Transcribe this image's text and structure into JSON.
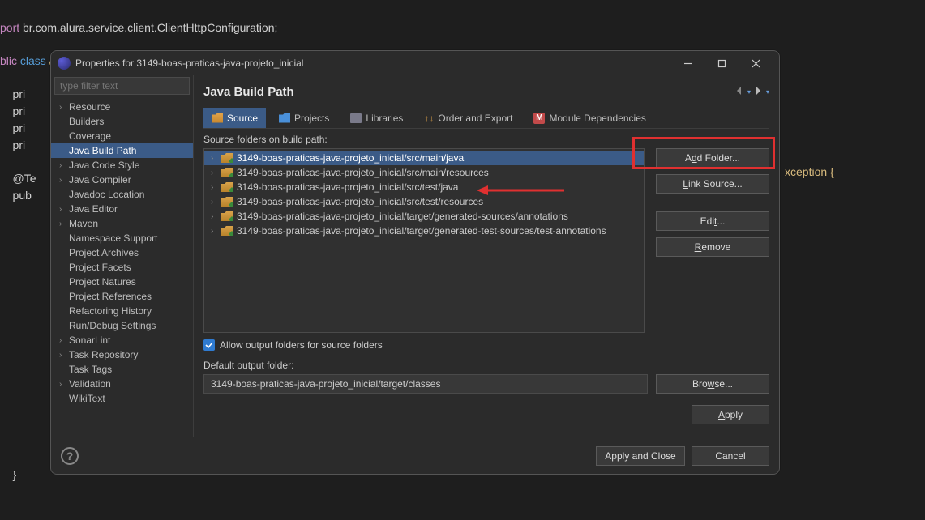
{
  "code": {
    "l1a": "port ",
    "l1b": "br.com.alura.service.client.ClientHttpConfiguration;",
    "l2a": "blic ",
    "l2b": "class ",
    "l2c": "AbrigoServiceTest ",
    "l2d": "{",
    "p1": "    pr",
    "p1b": "i",
    "p2": "    pr",
    "p2b": "i",
    "p3": "    pr",
    "p3b": "i",
    "p4": "    pr",
    "p4b": "i",
    "t1": "    @Te",
    "pu": "    pub",
    "tail": "xception {",
    "brace": "    }"
  },
  "dialog": {
    "title": "Properties for 3149-boas-praticas-java-projeto_inicial",
    "filter_placeholder": "type filter text",
    "sidebar": [
      {
        "label": "Resource",
        "expand": true
      },
      {
        "label": "Builders"
      },
      {
        "label": "Coverage"
      },
      {
        "label": "Java Build Path",
        "selected": true
      },
      {
        "label": "Java Code Style",
        "expand": true
      },
      {
        "label": "Java Compiler",
        "expand": true
      },
      {
        "label": "Javadoc Location"
      },
      {
        "label": "Java Editor",
        "expand": true
      },
      {
        "label": "Maven",
        "expand": true
      },
      {
        "label": "Namespace Support"
      },
      {
        "label": "Project Archives"
      },
      {
        "label": "Project Facets"
      },
      {
        "label": "Project Natures"
      },
      {
        "label": "Project References"
      },
      {
        "label": "Refactoring History"
      },
      {
        "label": "Run/Debug Settings"
      },
      {
        "label": "SonarLint",
        "expand": true
      },
      {
        "label": "Task Repository",
        "expand": true
      },
      {
        "label": "Task Tags"
      },
      {
        "label": "Validation",
        "expand": true
      },
      {
        "label": "WikiText"
      }
    ],
    "heading": "Java Build Path",
    "tabs": {
      "source": "Source",
      "projects": "Projects",
      "libraries": "Libraries",
      "order": "Order and Export",
      "module": "Module Dependencies"
    },
    "src_label": "Source folders on build path:",
    "src_items": [
      "3149-boas-praticas-java-projeto_inicial/src/main/java",
      "3149-boas-praticas-java-projeto_inicial/src/main/resources",
      "3149-boas-praticas-java-projeto_inicial/src/test/java",
      "3149-boas-praticas-java-projeto_inicial/src/test/resources",
      "3149-boas-praticas-java-projeto_inicial/target/generated-sources/annotations",
      "3149-boas-praticas-java-projeto_inicial/target/generated-test-sources/test-annotations"
    ],
    "buttons": {
      "add": "Add Folder...",
      "link": "Link Source...",
      "edit": "Edit...",
      "remove": "Remove",
      "browse": "Browse...",
      "apply": "Apply",
      "apply_close": "Apply and Close",
      "cancel": "Cancel"
    },
    "allow_label_pre": "Allow output folders for sour",
    "allow_label_ul": "c",
    "allow_label_post": "e folders",
    "default_out_label": "Default output folder:",
    "default_out_value": "3149-boas-praticas-java-projeto_inicial/target/classes"
  }
}
